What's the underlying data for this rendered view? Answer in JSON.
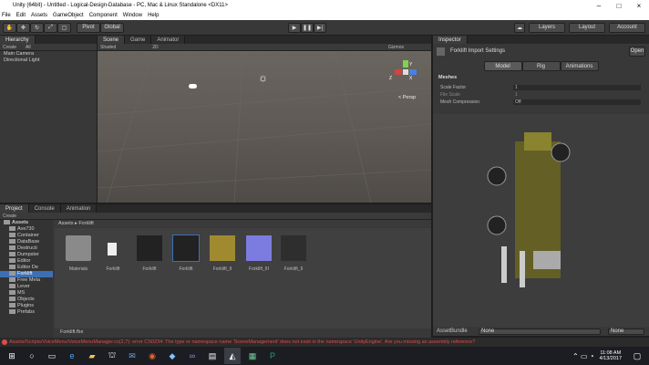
{
  "window": {
    "title": "Unity (64bit) - Untitled - Logical-Design-Database - PC, Mac & Linux Standalone <DX11>"
  },
  "menu": [
    "File",
    "Edit",
    "Assets",
    "GameObject",
    "Component",
    "Window",
    "Help"
  ],
  "toolbar": {
    "pivot": "Pivot",
    "global": "Global",
    "layers": "Layers",
    "layout": "Layout",
    "account": "Account"
  },
  "hierarchy": {
    "tab": "Hierarchy",
    "create": "Create",
    "search": "All",
    "items": [
      "Main Camera",
      "Directional Light"
    ]
  },
  "scene": {
    "tabs": [
      "Scene",
      "Game",
      "Animator"
    ],
    "shaded": "Shaded",
    "mode2d": "2D",
    "gizmos": "Gizmos",
    "persp": "< Persp",
    "axis_x": "X",
    "axis_z": "Z",
    "axis_y": "Y"
  },
  "inspector": {
    "tab": "Inspector",
    "title": "Forklift Import Settings",
    "open": "Open",
    "tabs": [
      "Model",
      "Rig",
      "Animations"
    ],
    "section": "Meshes",
    "rows": [
      {
        "label": "Scale Factor",
        "value": "1"
      },
      {
        "label": "File Scale",
        "value": "1"
      },
      {
        "label": "Mesh Compression",
        "value": "Off"
      }
    ],
    "assetbundle": "AssetBundle",
    "ab_value": "None",
    "ab_variant": "None"
  },
  "project": {
    "tabs": [
      "Project",
      "Console",
      "Animation"
    ],
    "create": "Create",
    "breadcrumb": "Assets ▸ Forklift",
    "tree": [
      "Assets",
      "Ave730",
      "Container",
      "DataBase",
      "Destructi",
      "Dumpster",
      "Editor",
      "Editor De",
      "Forklift",
      "Free Meta",
      "Lever",
      "MS",
      "Objects",
      "Plugins",
      "Prefabs"
    ],
    "assets": [
      "Materials",
      "Forklift",
      "Forklift",
      "Forklift",
      "Forklift_II",
      "Forklift_III",
      "Forklift_II"
    ],
    "selected_path": "Forklift.fbx"
  },
  "status": {
    "message": "Assets/Scripts/VoiceMenu/VoiceMenuManager.cs(2,7): error CS0234: The type or namespace name 'SceneManagement' does not exist in the namespace 'UnityEngine'. Are you missing an assembly reference?"
  },
  "taskbar": {
    "time": "11:08 AM",
    "date": "4/13/2017"
  },
  "colors": {
    "error": "#e24a4a",
    "accent": "#3d6fb5"
  }
}
